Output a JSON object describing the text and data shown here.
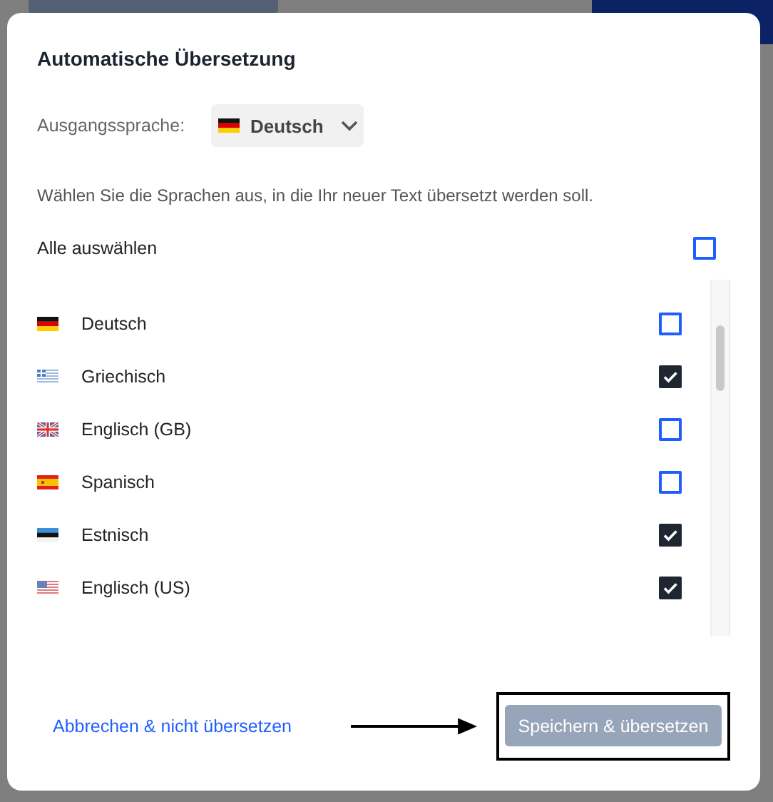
{
  "dialog": {
    "title": "Automatische Übersetzung",
    "source_label": "Ausgangssprache:",
    "source": {
      "label": "Deutsch",
      "kind": "de"
    },
    "instruction": "Wählen Sie die Sprachen aus, in die Ihr neuer Text übersetzt werden soll.",
    "select_all": {
      "label": "Alle auswählen",
      "checked": false
    },
    "languages": [
      {
        "name": "Deutsch",
        "kind": "de",
        "checked": false
      },
      {
        "name": "Griechisch",
        "kind": "gr",
        "checked": true
      },
      {
        "name": "Englisch (GB)",
        "kind": "gb",
        "checked": false
      },
      {
        "name": "Spanisch",
        "kind": "es",
        "checked": false
      },
      {
        "name": "Estnisch",
        "kind": "ee",
        "checked": true
      },
      {
        "name": "Englisch (US)",
        "kind": "us",
        "checked": true
      }
    ],
    "cancel": "Abbrechen & nicht übersetzen",
    "submit": {
      "label": "Speichern & übersetzen",
      "disabled": true
    }
  }
}
